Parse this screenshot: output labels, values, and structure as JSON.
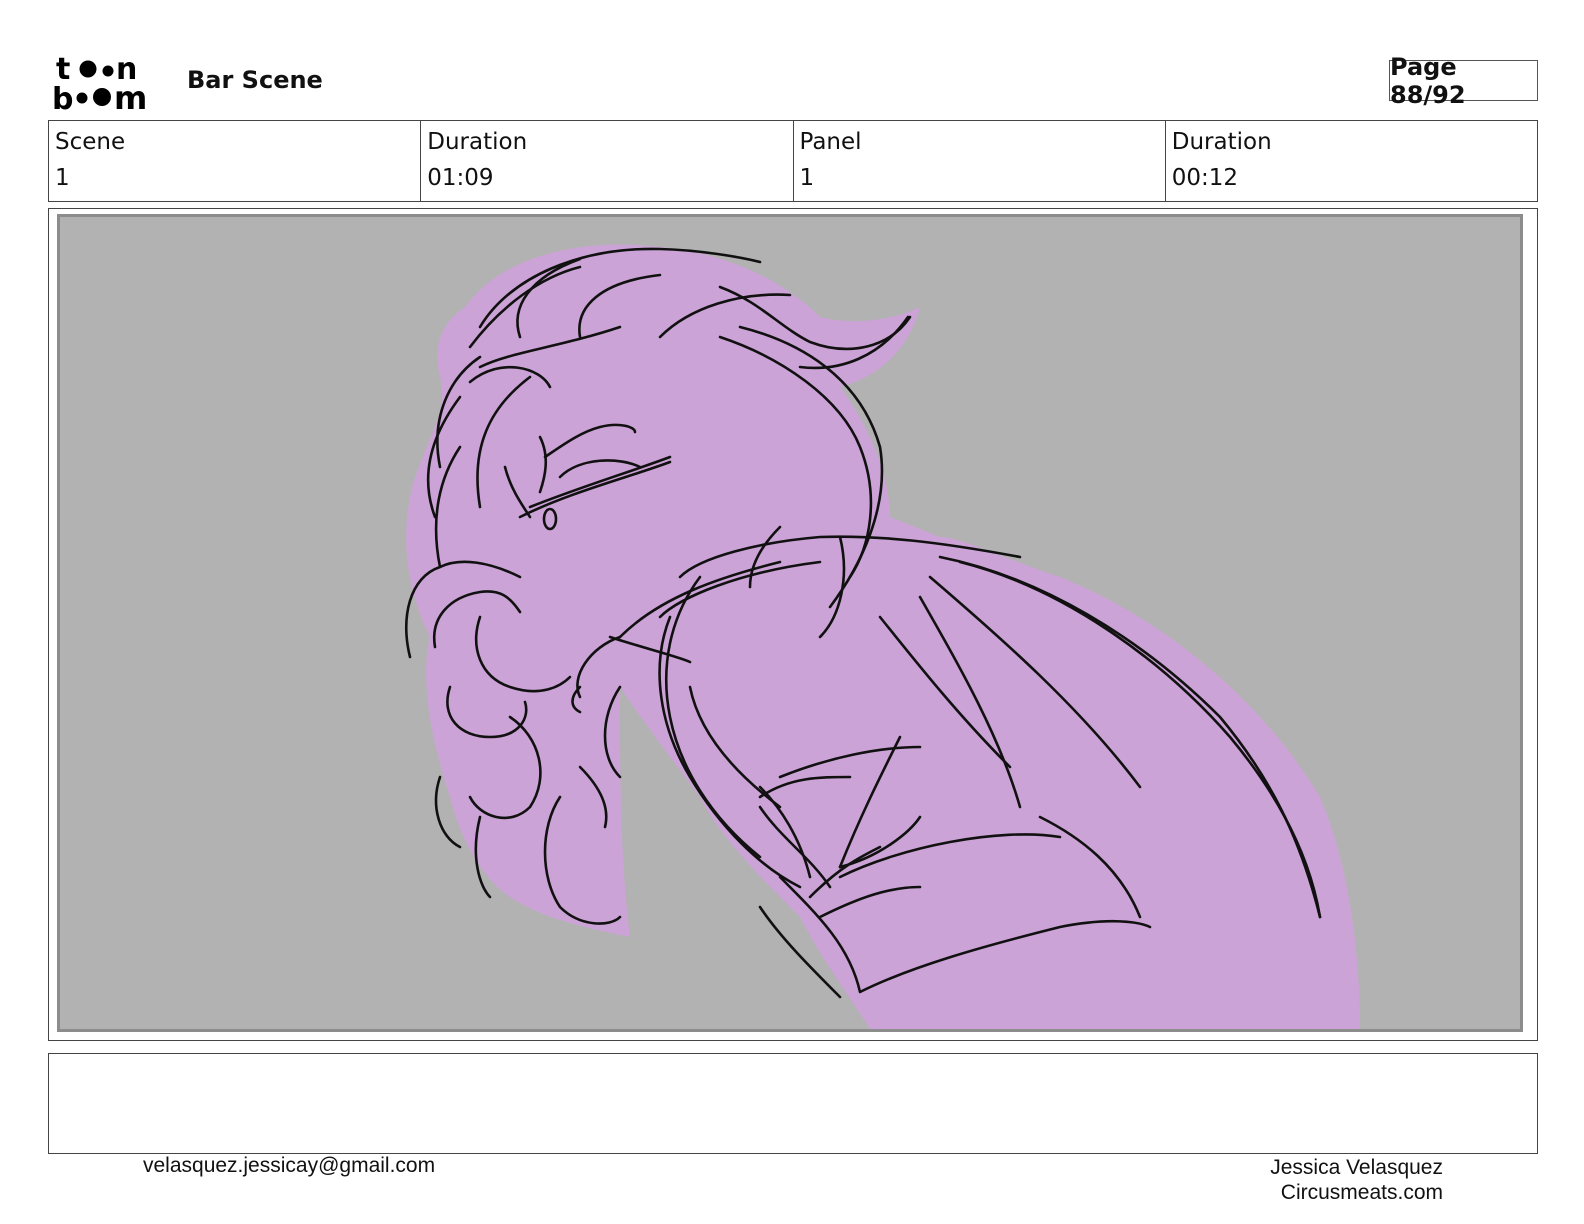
{
  "header": {
    "logo_text_top": "toon",
    "logo_text_bottom": "boom",
    "title": "Bar Scene",
    "page": "Page 88/92"
  },
  "info": {
    "scene_label": "Scene",
    "scene_value": "1",
    "scene_duration_label": "Duration",
    "scene_duration_value": "01:09",
    "panel_label": "Panel",
    "panel_value": "1",
    "panel_duration_label": "Duration",
    "panel_duration_value": "00:12"
  },
  "panel": {
    "background_color": "#b2b2b2",
    "fill_color": "#cca3d6",
    "line_color": "#111111"
  },
  "notes": {
    "text": ""
  },
  "footer": {
    "email": "velasquez.jessicay@gmail.com",
    "author": "Jessica Velasquez",
    "website": "Circusmeats.com"
  }
}
